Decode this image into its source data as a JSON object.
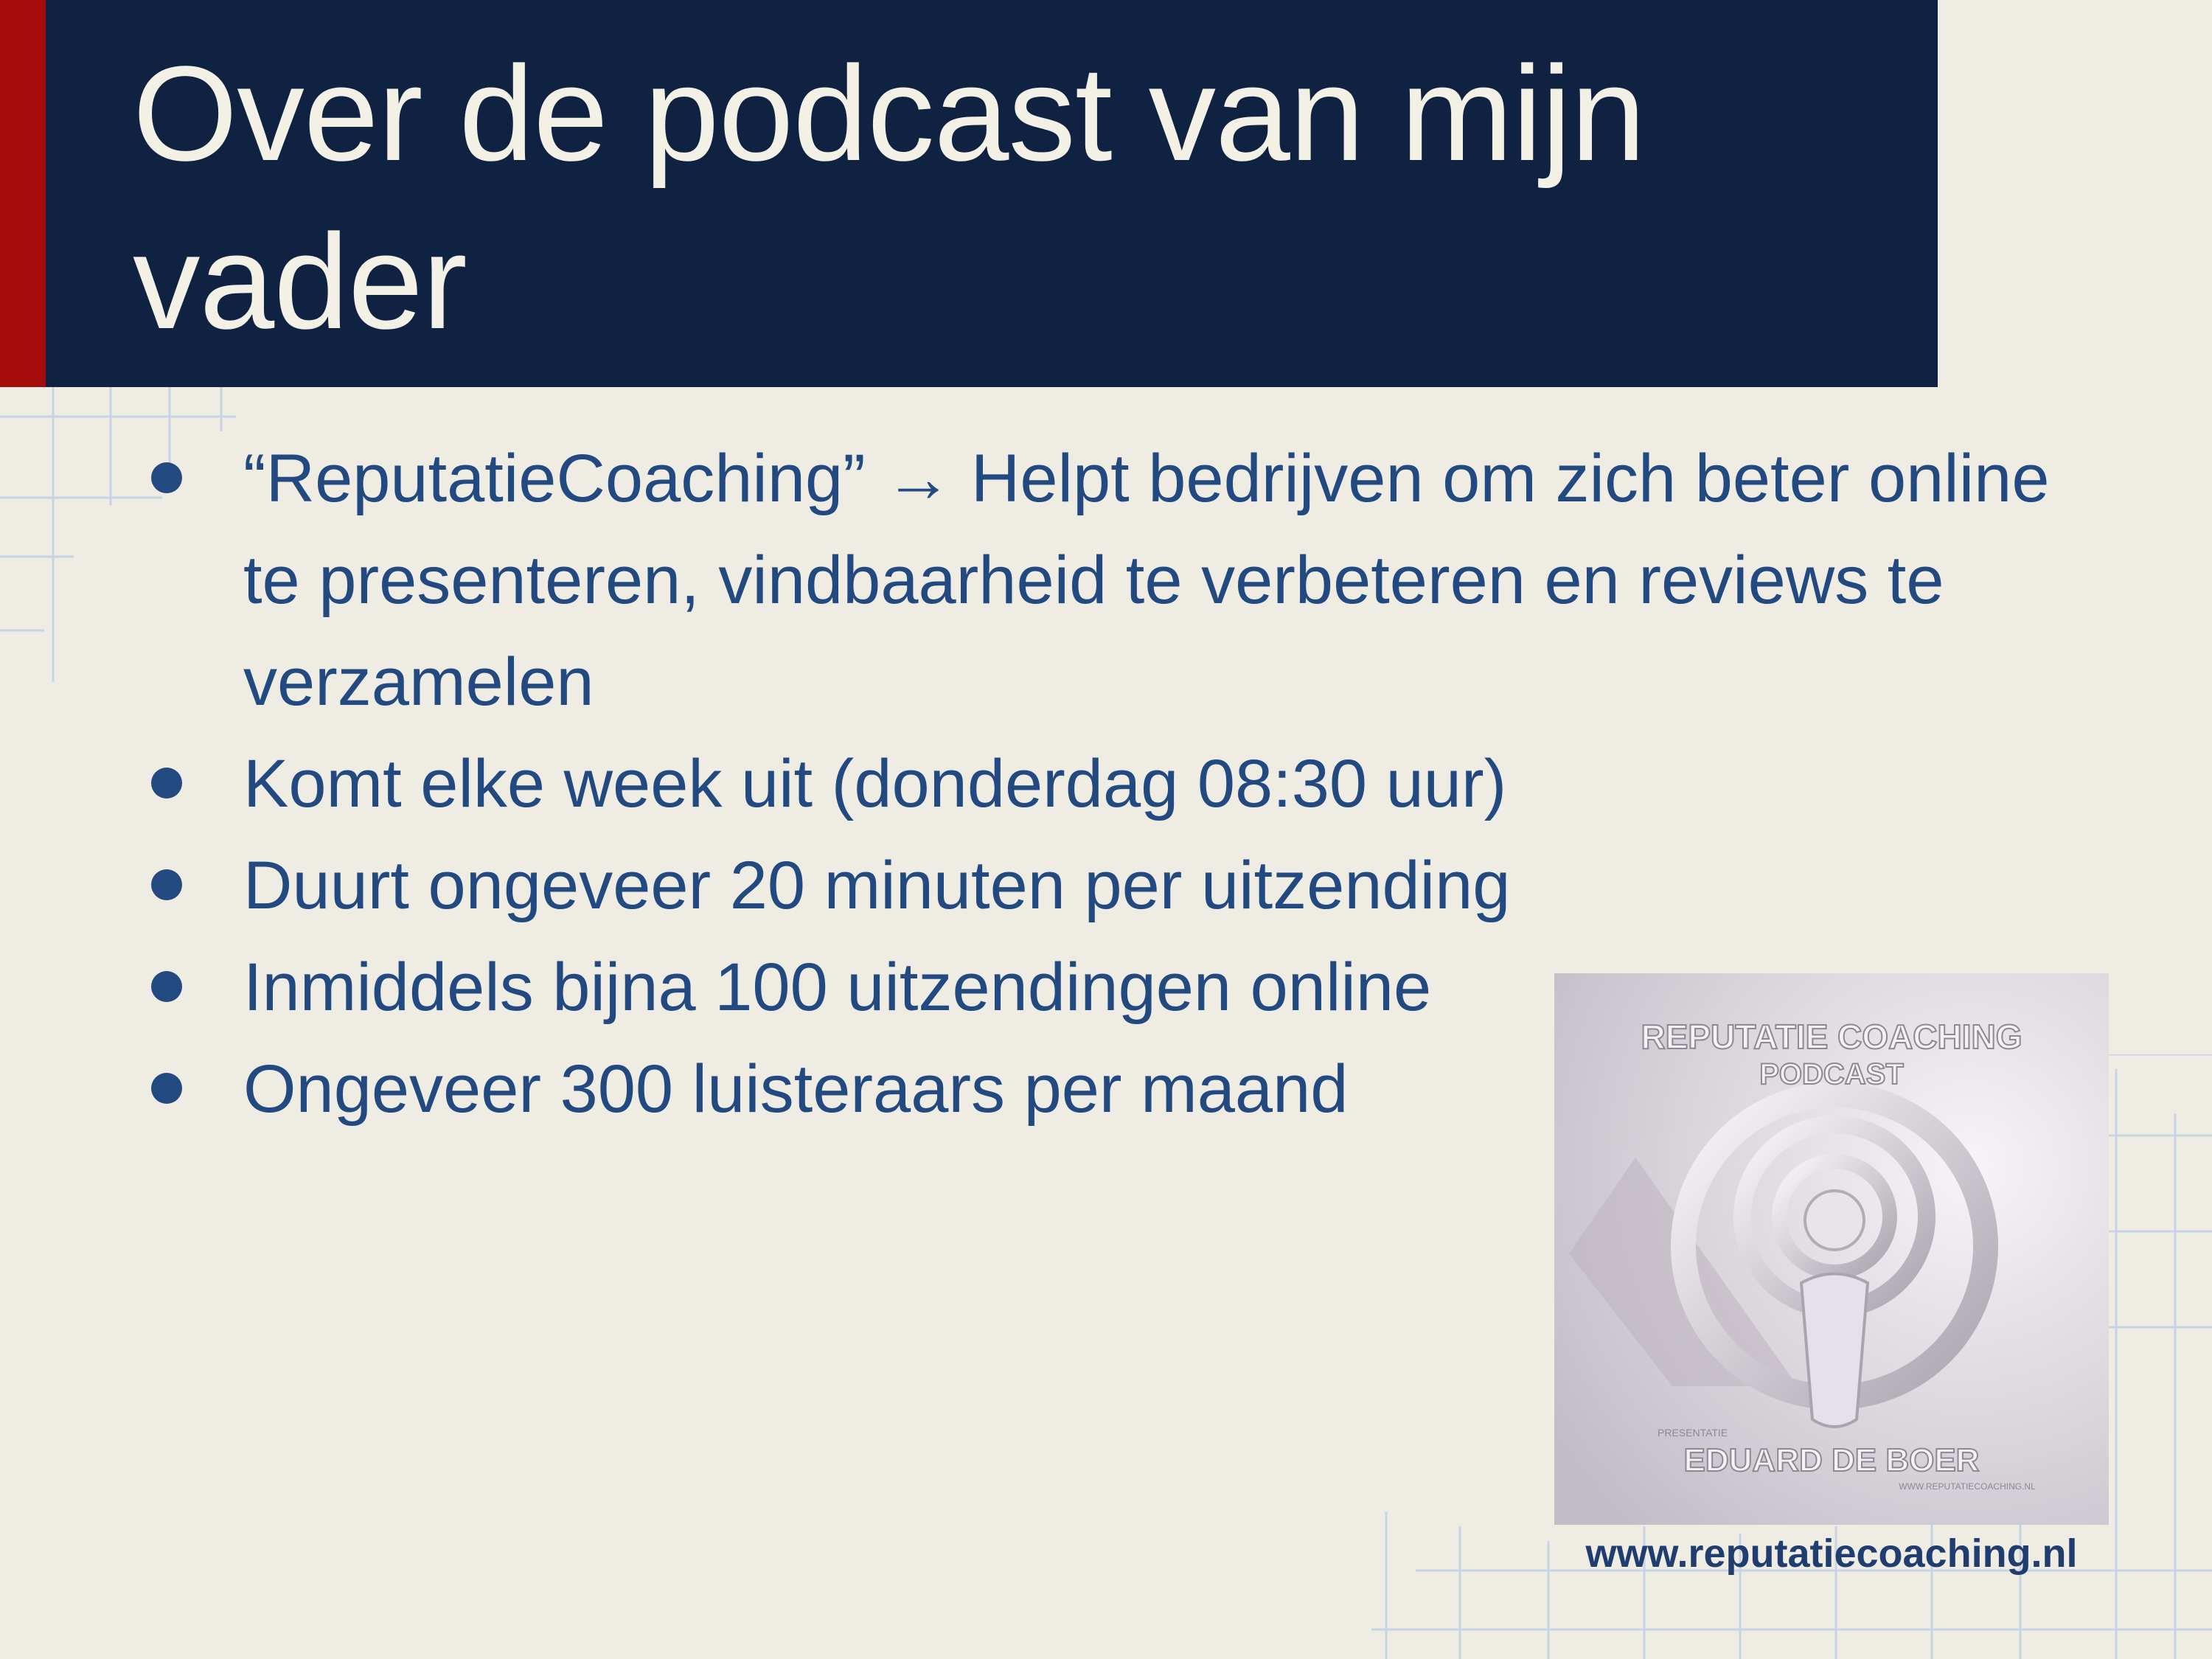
{
  "slide": {
    "title": "Over de podcast van mijn vader",
    "bullets": [
      "“ReputatieCoaching” → Helpt bedrijven om zich beter online te presenteren, vindbaarheid te verbeteren en reviews te verzamelen",
      "Komt elke week uit (donderdag 08:30 uur)",
      "Duurt ongeveer 20 minuten per uitzending",
      "Inmiddels bijna 100 uitzendingen online",
      "Ongeveer 300 luisteraars per maand"
    ]
  },
  "cover_image": {
    "heading": "REPUTATIE COACHING",
    "subheading": "PODCAST",
    "presenter_caption": "PRESENTATIE",
    "presenter": "EDUARD DE BOER",
    "small_url": "WWW.REPUTATIECOACHING.NL",
    "icon": "podcast-icon"
  },
  "website": "www.reputatiecoaching.nl",
  "colors": {
    "background": "#efede3",
    "title_bar": "#102241",
    "accent": "#a50d0d",
    "bullet_text": "#234a80"
  }
}
